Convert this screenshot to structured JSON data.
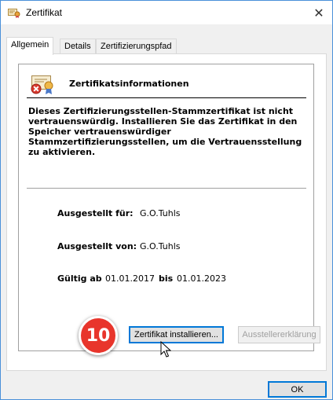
{
  "window": {
    "title": "Zertifikat"
  },
  "tabs": [
    {
      "label": "Allgemein",
      "active": true
    },
    {
      "label": "Details",
      "active": false
    },
    {
      "label": "Zertifizierungspfad",
      "active": false
    }
  ],
  "info": {
    "heading": "Zertifikatsinformationen",
    "warning": "Dieses Zertifizierungsstellen-Stammzertifikat ist nicht vertrauenswürdig. Installieren Sie das Zertifikat in den Speicher vertrauenswürdiger Stammzertifizierungsstellen, um die Vertrauensstellung zu aktivieren."
  },
  "details": {
    "issued_to_label": "Ausgestellt für:",
    "issued_to_value": "G.O.Tuhls",
    "issued_by_label": "Ausgestellt von:",
    "issued_by_value": "G.O.Tuhls",
    "valid_from_label": "Gültig ab",
    "valid_from_value": "01.01.2017",
    "valid_to_label": "bis",
    "valid_to_value": "01.01.2023"
  },
  "buttons": {
    "install_label": "Zertifikat installieren...",
    "issuer_statement_label": "Ausstellererklärung",
    "ok_label": "OK"
  },
  "annotation": {
    "step_number": "10",
    "color": "#e8352c"
  },
  "icons": {
    "title": "certificate-icon",
    "info": "certificate-error-icon",
    "close": "close-icon",
    "cursor": "mouse-pointer-icon"
  }
}
